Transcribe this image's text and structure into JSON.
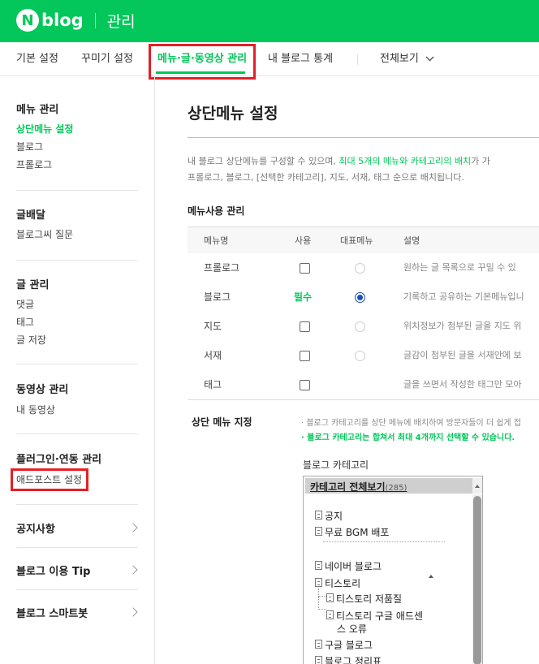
{
  "header": {
    "logo_letter": "N",
    "logo_text": "blog",
    "title": "관리"
  },
  "tabs": [
    {
      "label": "기본 설정",
      "active": false
    },
    {
      "label": "꾸미기 설정",
      "active": false
    },
    {
      "label": "메뉴·글·동영상 관리",
      "active": true
    },
    {
      "label": "내 블로그 통계",
      "active": false
    },
    {
      "label": "전체보기",
      "active": false
    }
  ],
  "sidebar": {
    "menu_title": "메뉴 관리",
    "menu_items": [
      "상단메뉴 설정",
      "블로그",
      "프롤로그"
    ],
    "post_title": "글배달",
    "post_items": [
      "블로그씨 질문"
    ],
    "write_title": "글 관리",
    "write_items": [
      "댓글",
      "태그",
      "글 저장"
    ],
    "video_title": "동영상 관리",
    "video_items": [
      "내 동영상"
    ],
    "plugin_title": "플러그인·연동 관리",
    "plugin_items": [
      "애드포스트 설정"
    ],
    "links": [
      "공지사항",
      "블로그 이용 Tip",
      "블로그 스마트봇"
    ]
  },
  "main": {
    "title": "상단메뉴 설정",
    "desc_line1_a": "내 블로그 상단메뉴를 구성할 수 있으며, ",
    "desc_line1_hl": "최대 5개의 메뉴와 카테고리의 배치",
    "desc_line1_b": "가 가",
    "desc_line2": "프롤로그, 블로그, [선택한 카테고리], 지도, 서재, 태그 순으로 배치됩니다.",
    "usage_heading": "메뉴사용 관리",
    "columns": [
      "메뉴명",
      "사용",
      "대표메뉴",
      "설명"
    ],
    "rows": [
      {
        "name": "프롤로그",
        "use": "",
        "desc": "원하는 글 목록으로 꾸밀 수 있"
      },
      {
        "name": "블로그",
        "use": "필수",
        "desc": "기록하고 공유하는 기본메뉴입니"
      },
      {
        "name": "지도",
        "use": "",
        "desc": "위치정보가 첨부된 글을 지도 위"
      },
      {
        "name": "서재",
        "use": "",
        "desc": "글감이 첨부된 글을 서재안에 보"
      },
      {
        "name": "태그",
        "use": "",
        "desc": "글을 쓰면서 작성한 태그만 모아"
      }
    ],
    "assign_heading": "상단 메뉴 지정",
    "note1": "· 블로그 카테고리를 상단 메뉴에 배치하여 방문자들이 더 쉽게 접",
    "note2": "· 블로그 카테고리는 합쳐서 최대 4개까지 선택할 수 있습니다.",
    "category_label": "블로그 카테고리",
    "category_header": "카테고리 전체보기",
    "category_count": "(285)",
    "categories": [
      "공지",
      "무료 BGM 배포",
      "네이버 블로그",
      "티스토리",
      "티스토리 저품질",
      "티스토리 구글 애드센",
      "스 오류",
      "구글 블로그",
      "블로그 정리표"
    ]
  },
  "colors": {
    "brand": "#03c75a",
    "highlight_box": "#e61f26",
    "radio_selected": "#1a4fb5"
  }
}
